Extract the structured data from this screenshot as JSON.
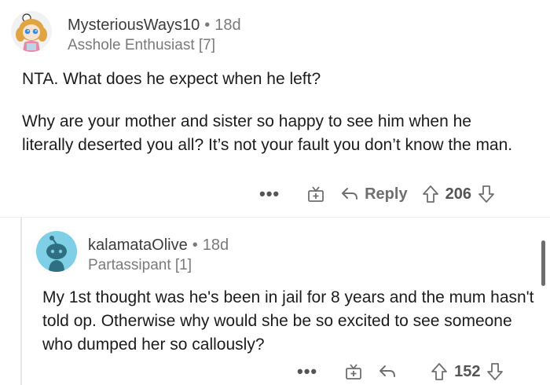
{
  "comments": [
    {
      "username": "MysteriousWays10",
      "age": "18d",
      "flair": "Asshole Enthusiast [7]",
      "paragraphs": [
        "NTA. What does he expect when he left?",
        "Why are your mother and sister so happy to see him when he literally deserted you all? It’s not your fault you don’t know the man."
      ],
      "dots": "•••",
      "reply_label": "Reply",
      "score": "206",
      "icons": {
        "award": "award-icon",
        "reply": "reply-arrow-icon",
        "upvote": "upvote-icon",
        "downvote": "downvote-icon"
      }
    },
    {
      "username": "kalamataOlive",
      "age": "18d",
      "flair": "Partassipant [1]",
      "paragraphs": [
        "My 1st thought was he's been in jail for 8 years and the mum hasn't told op. Otherwise why would she be so excited to see someone who dumped her so callously?"
      ],
      "dots": "•••",
      "score": "152",
      "icons": {
        "award": "award-icon",
        "reply": "reply-arrow-icon",
        "upvote": "upvote-icon",
        "downvote": "downvote-icon"
      }
    }
  ],
  "separator": "•"
}
